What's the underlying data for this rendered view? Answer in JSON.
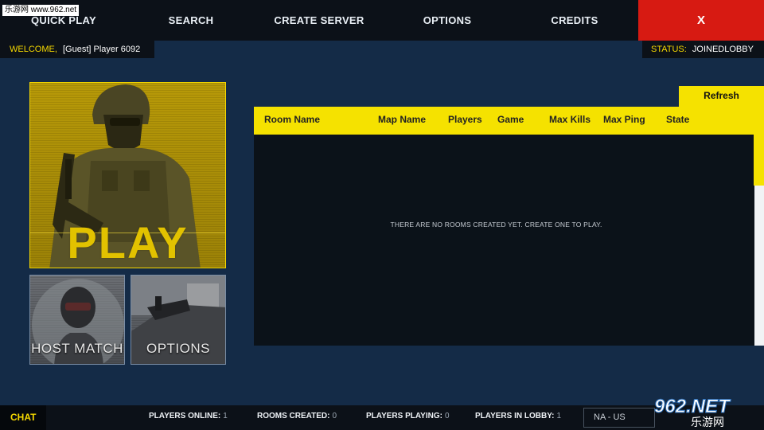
{
  "nav": {
    "items": [
      {
        "label": "QUICK PLAY"
      },
      {
        "label": "SEARCH"
      },
      {
        "label": "CREATE SERVER"
      },
      {
        "label": "OPTIONS"
      },
      {
        "label": "CREDITS"
      }
    ],
    "close_label": "X"
  },
  "watermark": {
    "top_text": "乐游网 www.962.net",
    "logo_text": "962.NET",
    "logo_subtext": "乐游网"
  },
  "welcome": {
    "label": "WELCOME,",
    "player": "[Guest] Player 6092"
  },
  "status": {
    "label": "STATUS:",
    "value": "JOINEDLOBBY"
  },
  "tiles": {
    "play": "PLAY",
    "host_match": "HOST MATCH",
    "options": "OPTIONS"
  },
  "rooms": {
    "refresh_label": "Refresh",
    "columns": [
      "Room Name",
      "Map Name",
      "Players",
      "Game",
      "Max Kills",
      "Max Ping",
      "State"
    ],
    "empty_message": "THERE ARE NO ROOMS CREATED YET. CREATE ONE TO PLAY."
  },
  "bottom": {
    "chat_label": "CHAT",
    "stats": [
      {
        "label": "PLAYERS ONLINE:",
        "value": "1"
      },
      {
        "label": "ROOMS CREATED:",
        "value": "0"
      },
      {
        "label": "PLAYERS PLAYING:",
        "value": "0"
      },
      {
        "label": "PLAYERS IN LOBBY:",
        "value": "1"
      }
    ],
    "region": "NA - US"
  },
  "colors": {
    "accent": "#f5d800",
    "background": "#142b47",
    "close": "#d71a12",
    "bar": "#0c1118"
  }
}
